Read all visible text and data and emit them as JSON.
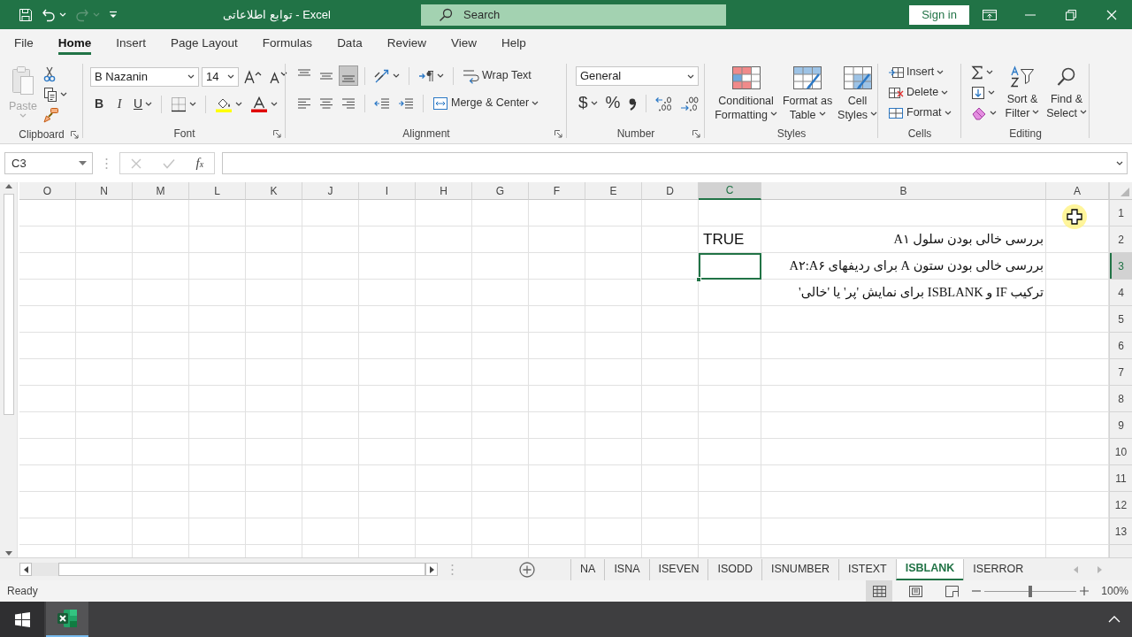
{
  "window": {
    "title": "توابع اطلاعاتی - Excel",
    "search_placeholder": "Search",
    "sign_in": "Sign in"
  },
  "quick_access": [
    {
      "kind": "save",
      "disabled": false
    },
    {
      "kind": "undo",
      "disabled": false
    },
    {
      "kind": "redo",
      "disabled": true
    },
    {
      "kind": "customize",
      "disabled": false
    }
  ],
  "ribbon_tabs": [
    {
      "label": "File",
      "selected": false
    },
    {
      "label": "Home",
      "selected": true
    },
    {
      "label": "Insert",
      "selected": false
    },
    {
      "label": "Page Layout",
      "selected": false
    },
    {
      "label": "Formulas",
      "selected": false
    },
    {
      "label": "Data",
      "selected": false
    },
    {
      "label": "Review",
      "selected": false
    },
    {
      "label": "View",
      "selected": false
    },
    {
      "label": "Help",
      "selected": false
    }
  ],
  "ribbon": {
    "clipboard": {
      "label": "Clipboard",
      "paste": "Paste",
      "paste_disabled": true
    },
    "font": {
      "label": "Font",
      "font_name": "B Nazanin",
      "font_size": "14",
      "format_buttons": [
        {
          "kind": "bold",
          "label": "B"
        },
        {
          "kind": "italic",
          "label": "I"
        },
        {
          "kind": "underline",
          "label": "U"
        }
      ]
    },
    "alignment": {
      "label": "Alignment",
      "vertical_align": [
        {
          "kind": "top",
          "selected": false
        },
        {
          "kind": "middle",
          "selected": false
        },
        {
          "kind": "bottom",
          "selected": true
        }
      ],
      "wrap_text": "Wrap Text",
      "merge": "Merge & Center"
    },
    "number": {
      "label": "Number",
      "format": "General",
      "currency": "$",
      "percent": "%"
    },
    "styles": {
      "label": "Styles",
      "buttons": [
        {
          "kind": "conditional",
          "label": "Conditional Formatting"
        },
        {
          "kind": "table",
          "label": "Format as Table"
        },
        {
          "kind": "cell",
          "label": "Cell Styles"
        }
      ]
    },
    "cells": {
      "label": "Cells",
      "buttons": [
        {
          "kind": "insert",
          "label": "Insert"
        },
        {
          "kind": "delete",
          "label": "Delete"
        },
        {
          "kind": "format",
          "label": "Format"
        }
      ]
    },
    "editing": {
      "label": "Editing",
      "buttons": [
        {
          "kind": "sort",
          "label": "Sort & Filter"
        },
        {
          "kind": "find",
          "label": "Find & Select"
        }
      ]
    }
  },
  "formula_bar": {
    "name_box": "C3",
    "cancel_disabled": true,
    "enter_disabled": true,
    "insert_function": "f$_{x}$"
  },
  "sheet": {
    "columns": [
      {
        "label": "O",
        "selected": false
      },
      {
        "label": "N",
        "selected": false
      },
      {
        "label": "M",
        "selected": false
      },
      {
        "label": "L",
        "selected": false
      },
      {
        "label": "K",
        "selected": false
      },
      {
        "label": "J",
        "selected": false
      },
      {
        "label": "I",
        "selected": false
      },
      {
        "label": "H",
        "selected": false
      },
      {
        "label": "G",
        "selected": false
      },
      {
        "label": "F",
        "selected": false
      },
      {
        "label": "E",
        "selected": false
      },
      {
        "label": "D",
        "selected": false
      },
      {
        "label": "C",
        "selected": true
      },
      {
        "label": "B",
        "selected": false
      },
      {
        "label": "A",
        "selected": false
      }
    ],
    "rows": [
      {
        "number": "1",
        "selected": false
      },
      {
        "number": "2",
        "selected": false,
        "column_b": "بررسی خالی بودن سلول A۱",
        "column_c": "TRUE"
      },
      {
        "number": "3",
        "selected": true,
        "column_b": "بررسی خالی بودن ستون A برای ردیفهای A۲:A۶"
      },
      {
        "number": "4",
        "selected": false,
        "column_b": "ترکیب IF و ISBLANK برای نمایش 'پر' یا 'خالی'"
      },
      {
        "number": "5",
        "selected": false
      },
      {
        "number": "6",
        "selected": false
      },
      {
        "number": "7",
        "selected": false
      },
      {
        "number": "8",
        "selected": false
      },
      {
        "number": "9",
        "selected": false
      },
      {
        "number": "10",
        "selected": false
      },
      {
        "number": "11",
        "selected": false
      },
      {
        "number": "12",
        "selected": false
      },
      {
        "number": "13",
        "selected": false
      }
    ]
  },
  "sheet_tabs": [
    {
      "label": "NA",
      "selected": false
    },
    {
      "label": "ISNA",
      "selected": false
    },
    {
      "label": "ISEVEN",
      "selected": false
    },
    {
      "label": "ISODD",
      "selected": false
    },
    {
      "label": "ISNUMBER",
      "selected": false
    },
    {
      "label": "ISTEXT",
      "selected": false
    },
    {
      "label": "ISBLANK",
      "selected": true
    },
    {
      "label": "ISERROR",
      "selected": false
    }
  ],
  "status_bar": {
    "text": "Ready",
    "views": [
      {
        "kind": "normal",
        "selected": true
      },
      {
        "kind": "page_layout",
        "selected": false
      },
      {
        "kind": "page_break",
        "selected": false
      }
    ],
    "zoom": {
      "level": 0.5,
      "reading": "100%"
    }
  },
  "taskbar": {
    "apps": [
      {
        "kind": "excel",
        "selected": true
      }
    ]
  }
}
